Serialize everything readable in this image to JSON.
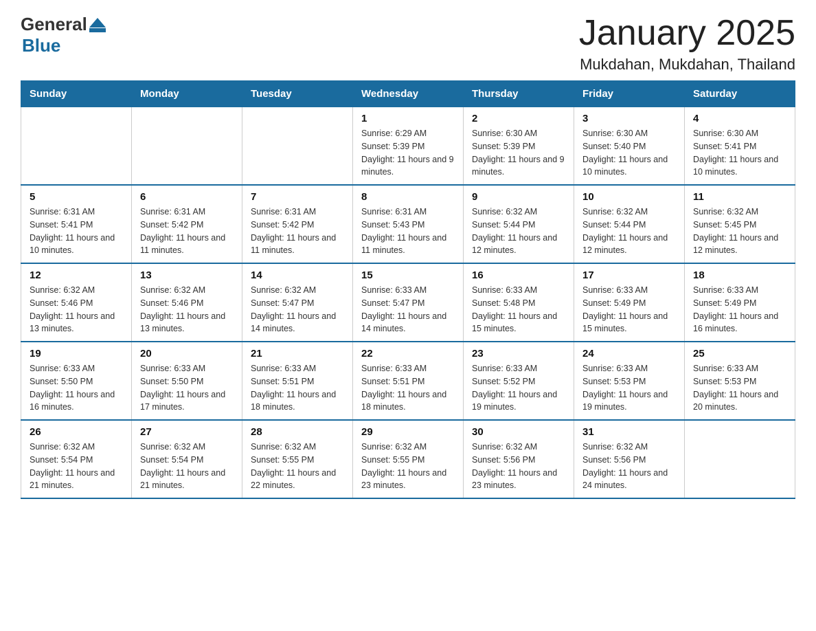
{
  "logo": {
    "general": "General",
    "arrow": "▲",
    "blue": "Blue"
  },
  "header": {
    "title": "January 2025",
    "subtitle": "Mukdahan, Mukdahan, Thailand"
  },
  "days_of_week": [
    "Sunday",
    "Monday",
    "Tuesday",
    "Wednesday",
    "Thursday",
    "Friday",
    "Saturday"
  ],
  "weeks": [
    [
      {
        "day": "",
        "info": ""
      },
      {
        "day": "",
        "info": ""
      },
      {
        "day": "",
        "info": ""
      },
      {
        "day": "1",
        "info": "Sunrise: 6:29 AM\nSunset: 5:39 PM\nDaylight: 11 hours and 9 minutes."
      },
      {
        "day": "2",
        "info": "Sunrise: 6:30 AM\nSunset: 5:39 PM\nDaylight: 11 hours and 9 minutes."
      },
      {
        "day": "3",
        "info": "Sunrise: 6:30 AM\nSunset: 5:40 PM\nDaylight: 11 hours and 10 minutes."
      },
      {
        "day": "4",
        "info": "Sunrise: 6:30 AM\nSunset: 5:41 PM\nDaylight: 11 hours and 10 minutes."
      }
    ],
    [
      {
        "day": "5",
        "info": "Sunrise: 6:31 AM\nSunset: 5:41 PM\nDaylight: 11 hours and 10 minutes."
      },
      {
        "day": "6",
        "info": "Sunrise: 6:31 AM\nSunset: 5:42 PM\nDaylight: 11 hours and 11 minutes."
      },
      {
        "day": "7",
        "info": "Sunrise: 6:31 AM\nSunset: 5:42 PM\nDaylight: 11 hours and 11 minutes."
      },
      {
        "day": "8",
        "info": "Sunrise: 6:31 AM\nSunset: 5:43 PM\nDaylight: 11 hours and 11 minutes."
      },
      {
        "day": "9",
        "info": "Sunrise: 6:32 AM\nSunset: 5:44 PM\nDaylight: 11 hours and 12 minutes."
      },
      {
        "day": "10",
        "info": "Sunrise: 6:32 AM\nSunset: 5:44 PM\nDaylight: 11 hours and 12 minutes."
      },
      {
        "day": "11",
        "info": "Sunrise: 6:32 AM\nSunset: 5:45 PM\nDaylight: 11 hours and 12 minutes."
      }
    ],
    [
      {
        "day": "12",
        "info": "Sunrise: 6:32 AM\nSunset: 5:46 PM\nDaylight: 11 hours and 13 minutes."
      },
      {
        "day": "13",
        "info": "Sunrise: 6:32 AM\nSunset: 5:46 PM\nDaylight: 11 hours and 13 minutes."
      },
      {
        "day": "14",
        "info": "Sunrise: 6:32 AM\nSunset: 5:47 PM\nDaylight: 11 hours and 14 minutes."
      },
      {
        "day": "15",
        "info": "Sunrise: 6:33 AM\nSunset: 5:47 PM\nDaylight: 11 hours and 14 minutes."
      },
      {
        "day": "16",
        "info": "Sunrise: 6:33 AM\nSunset: 5:48 PM\nDaylight: 11 hours and 15 minutes."
      },
      {
        "day": "17",
        "info": "Sunrise: 6:33 AM\nSunset: 5:49 PM\nDaylight: 11 hours and 15 minutes."
      },
      {
        "day": "18",
        "info": "Sunrise: 6:33 AM\nSunset: 5:49 PM\nDaylight: 11 hours and 16 minutes."
      }
    ],
    [
      {
        "day": "19",
        "info": "Sunrise: 6:33 AM\nSunset: 5:50 PM\nDaylight: 11 hours and 16 minutes."
      },
      {
        "day": "20",
        "info": "Sunrise: 6:33 AM\nSunset: 5:50 PM\nDaylight: 11 hours and 17 minutes."
      },
      {
        "day": "21",
        "info": "Sunrise: 6:33 AM\nSunset: 5:51 PM\nDaylight: 11 hours and 18 minutes."
      },
      {
        "day": "22",
        "info": "Sunrise: 6:33 AM\nSunset: 5:51 PM\nDaylight: 11 hours and 18 minutes."
      },
      {
        "day": "23",
        "info": "Sunrise: 6:33 AM\nSunset: 5:52 PM\nDaylight: 11 hours and 19 minutes."
      },
      {
        "day": "24",
        "info": "Sunrise: 6:33 AM\nSunset: 5:53 PM\nDaylight: 11 hours and 19 minutes."
      },
      {
        "day": "25",
        "info": "Sunrise: 6:33 AM\nSunset: 5:53 PM\nDaylight: 11 hours and 20 minutes."
      }
    ],
    [
      {
        "day": "26",
        "info": "Sunrise: 6:32 AM\nSunset: 5:54 PM\nDaylight: 11 hours and 21 minutes."
      },
      {
        "day": "27",
        "info": "Sunrise: 6:32 AM\nSunset: 5:54 PM\nDaylight: 11 hours and 21 minutes."
      },
      {
        "day": "28",
        "info": "Sunrise: 6:32 AM\nSunset: 5:55 PM\nDaylight: 11 hours and 22 minutes."
      },
      {
        "day": "29",
        "info": "Sunrise: 6:32 AM\nSunset: 5:55 PM\nDaylight: 11 hours and 23 minutes."
      },
      {
        "day": "30",
        "info": "Sunrise: 6:32 AM\nSunset: 5:56 PM\nDaylight: 11 hours and 23 minutes."
      },
      {
        "day": "31",
        "info": "Sunrise: 6:32 AM\nSunset: 5:56 PM\nDaylight: 11 hours and 24 minutes."
      },
      {
        "day": "",
        "info": ""
      }
    ]
  ]
}
